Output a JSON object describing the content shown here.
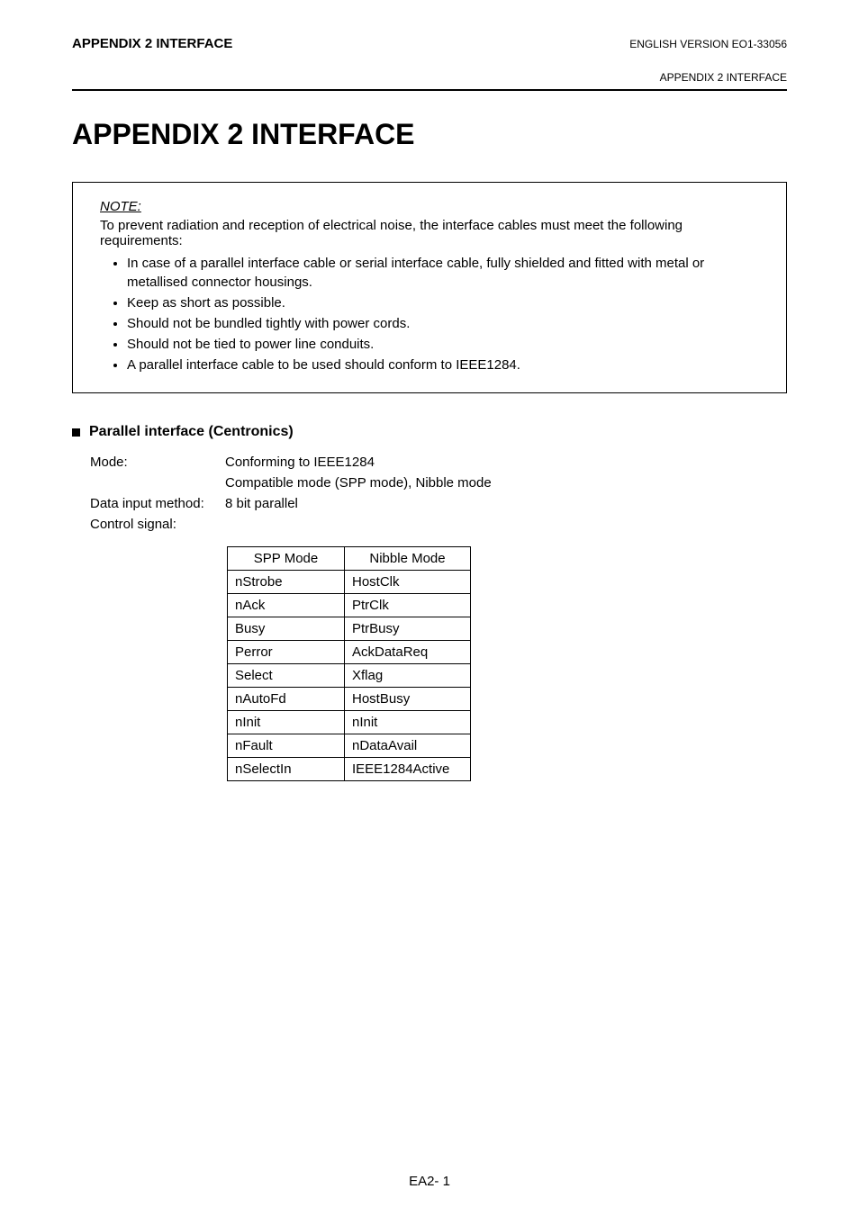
{
  "header": {
    "left": "APPENDIX 2  INTERFACE",
    "rightTop": "ENGLISH VERSION EO1-33056",
    "rightSub": "APPENDIX 2  INTERFACE"
  },
  "title": "APPENDIX 2  INTERFACE",
  "noteBox": {
    "titleItalic": "NOTE:",
    "intro": "To prevent radiation and reception of electrical noise, the interface cables must meet the following requirements:",
    "bullets": [
      "In case of a parallel interface cable or serial interface cable, fully shielded and fitted with metal or metallised connector housings.",
      "Keep as short as possible.",
      "Should not be bundled tightly with power cords.",
      "Should not be tied to power line conduits.",
      "A parallel interface cable to be used should conform to IEEE1284."
    ]
  },
  "section": {
    "title": "Parallel interface (Centronics)",
    "specs": {
      "modeLabel": "Mode:",
      "modeValue": "Conforming to IEEE1284",
      "modeSub": "Compatible mode (SPP mode), Nibble mode",
      "dataLabel": "Data input method:",
      "dataValue": "8 bit parallel",
      "signalLabel": "Control signal:"
    }
  },
  "chart_data": {
    "type": "table",
    "title": "Control signal",
    "headers": [
      "SPP Mode",
      "Nibble Mode"
    ],
    "rows": [
      [
        "nStrobe",
        "HostClk"
      ],
      [
        "nAck",
        "PtrClk"
      ],
      [
        "Busy",
        "PtrBusy"
      ],
      [
        "Perror",
        "AckDataReq"
      ],
      [
        "Select",
        "Xflag"
      ],
      [
        "nAutoFd",
        "HostBusy"
      ],
      [
        "nInit",
        "nInit"
      ],
      [
        "nFault",
        "nDataAvail"
      ],
      [
        "nSelectIn",
        "IEEE1284Active"
      ]
    ]
  },
  "footer": "EA2- 1"
}
